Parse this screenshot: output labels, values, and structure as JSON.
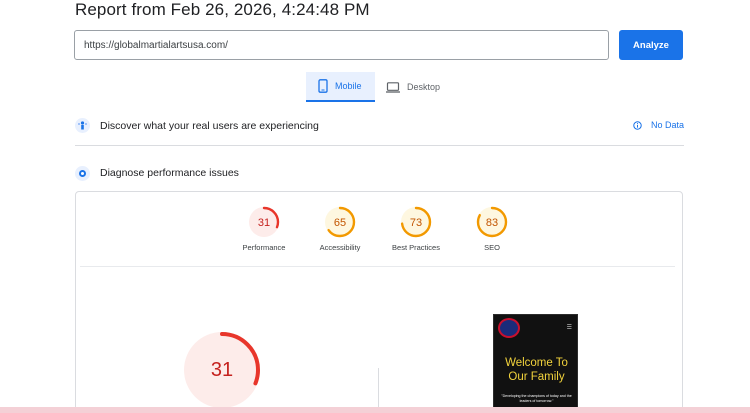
{
  "report": {
    "title": "Report from Feb 26, 2026, 4:24:48 PM"
  },
  "search": {
    "url": "https://globalmartialartsusa.com/",
    "analyze_label": "Analyze"
  },
  "tabs": [
    {
      "label": "Mobile"
    },
    {
      "label": "Desktop"
    }
  ],
  "sections": {
    "real_users": {
      "label": "Discover what your real users are experiencing",
      "status": "No Data"
    },
    "diagnose": {
      "label": "Diagnose performance issues"
    }
  },
  "scores": [
    {
      "label": "Performance",
      "value": 31,
      "color": "#e8362b"
    },
    {
      "label": "Accessibility",
      "value": 65,
      "color": "#f29900"
    },
    {
      "label": "Best Practices",
      "value": 73,
      "color": "#f29900"
    },
    {
      "label": "SEO",
      "value": 83,
      "color": "#f29900"
    }
  ],
  "main_score": {
    "value": 31,
    "color": "#e8362b"
  },
  "screenshot": {
    "heading": "Welcome To Our Family",
    "tagline": "\"Developing the champions of today and the leaders of tomorrow.\""
  }
}
